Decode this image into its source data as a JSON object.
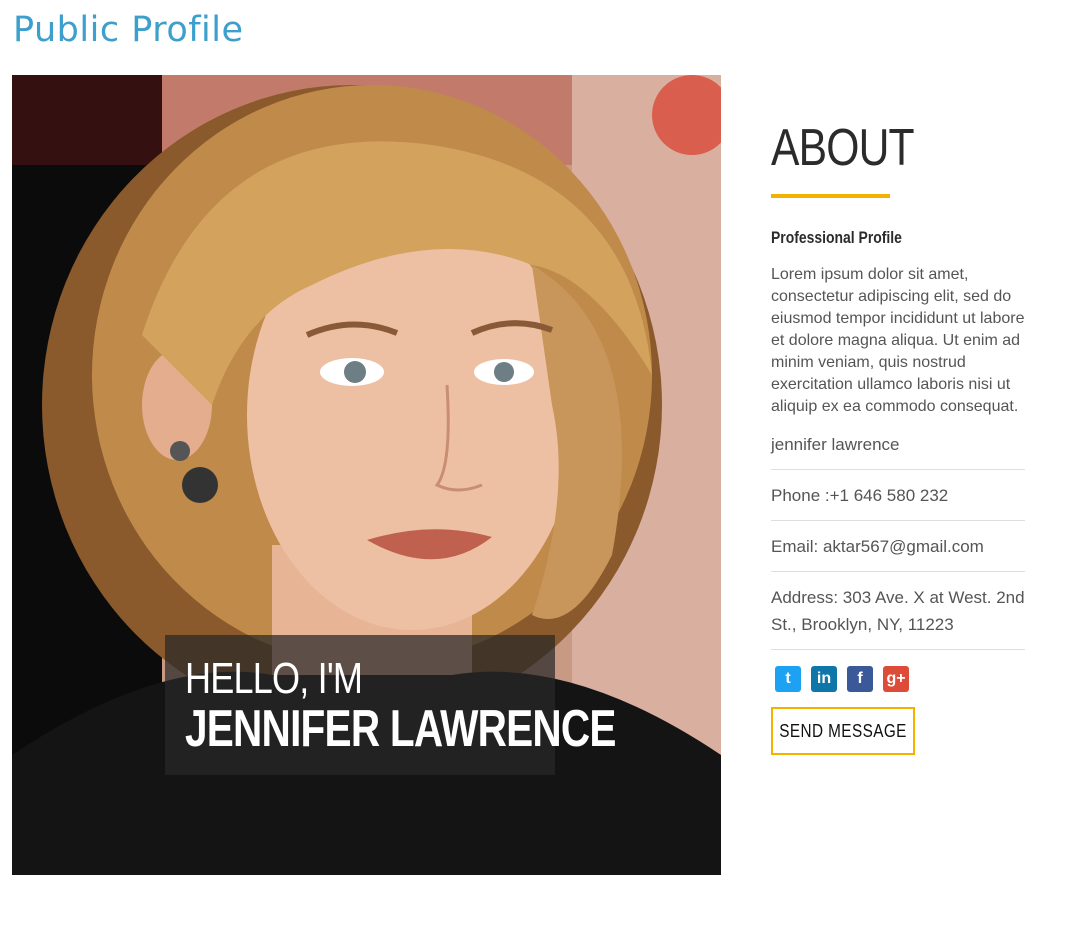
{
  "page": {
    "title": "Public Profile"
  },
  "hero": {
    "greeting": "HELLO, I'M",
    "name": "JENNIFER LAWRENCE",
    "photo_alt": "profile-photo"
  },
  "about": {
    "heading": "ABOUT",
    "subheading": "Professional Profile",
    "bio": "Lorem ipsum dolor sit amet, consectetur adipiscing elit, sed do eiusmod tempor incididunt ut labore et dolore magna aliqua. Ut enim ad minim veniam, quis nostrud exercitation ullamco laboris nisi ut aliquip ex ea commodo consequat.",
    "name": "jennifer lawrence",
    "phone": "Phone :+1 646 580 232",
    "email": "Email: aktar567@gmail.com",
    "address": "Address: 303 Ave. X at West. 2nd St., Brooklyn, NY, 11223",
    "send_label": "SEND MESSAGE"
  },
  "social": [
    {
      "icon": "twitter-icon",
      "glyph": "t",
      "color": "#1da1f2"
    },
    {
      "icon": "linkedin-icon",
      "glyph": "in",
      "color": "#0e76a8"
    },
    {
      "icon": "facebook-icon",
      "glyph": "f",
      "color": "#3b5998"
    },
    {
      "icon": "google-plus-icon",
      "glyph": "g+",
      "color": "#dd4b39"
    }
  ],
  "colors": {
    "title": "#3d9fcc",
    "accent": "#f3b200",
    "text": "#555555"
  }
}
